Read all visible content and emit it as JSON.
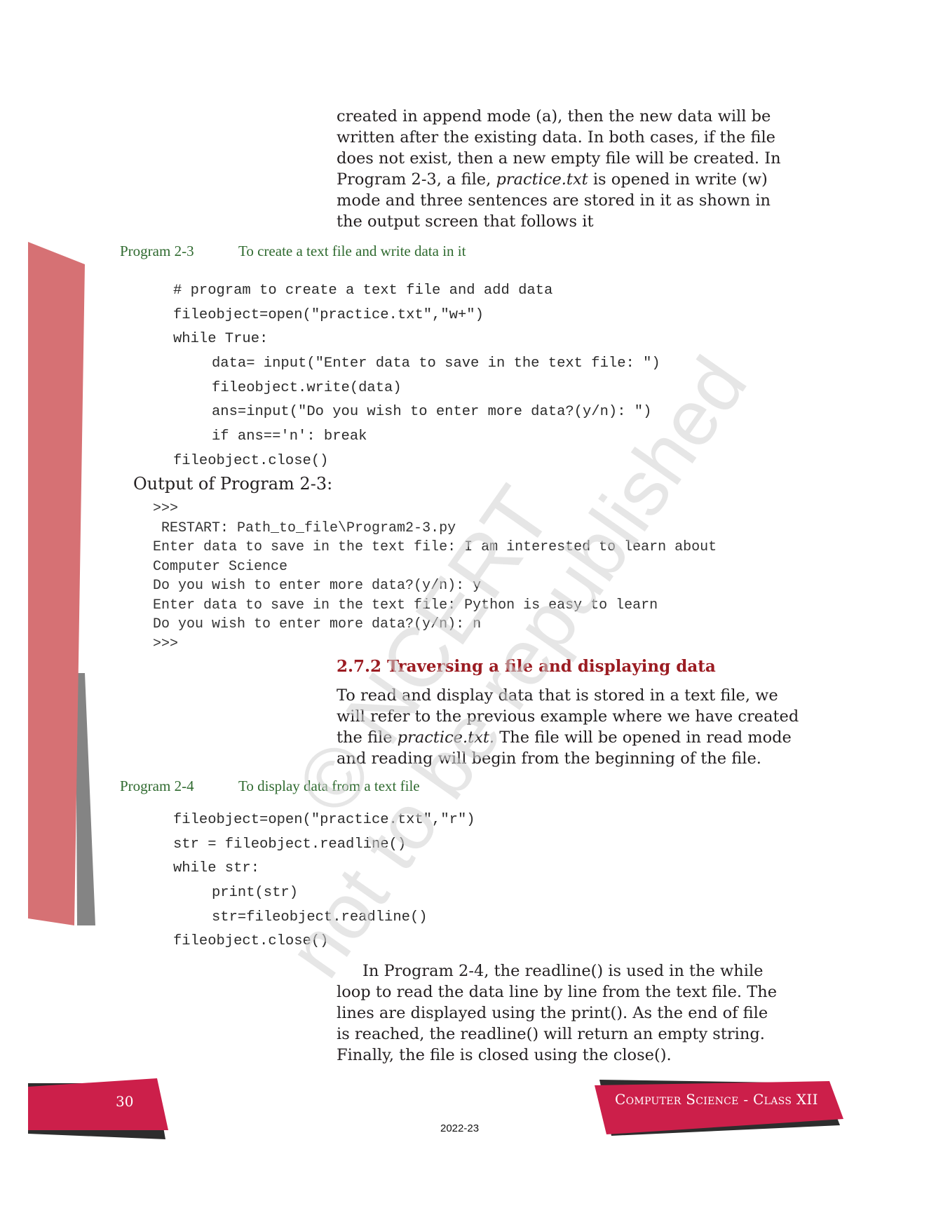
{
  "intro_paragraph": {
    "lines": [
      "created in append mode (a), then the new data will be",
      "written after the existing data. In both cases, if the file",
      "does not exist, then a new empty file will be created. In",
      "Program 2-3, a file, ",
      "mode and three sentences are stored in it as shown in",
      "the output screen that follows it"
    ],
    "line4_italic": "practice.txt",
    "line4_rest": " is opened in write (w)"
  },
  "program_2_3": {
    "number": "Program 2-3",
    "title": "To create a text file and write data in it",
    "code": [
      {
        "indent": 0,
        "text": "# program to create a text file and add data"
      },
      {
        "indent": 0,
        "text": "fileobject=open(\"practice.txt\",\"w+\")"
      },
      {
        "indent": 0,
        "text": "while True:"
      },
      {
        "indent": 1,
        "text": "data= input(\"Enter data to save in the text file: \")"
      },
      {
        "indent": 1,
        "text": "fileobject.write(data)"
      },
      {
        "indent": 1,
        "text": "ans=input(\"Do you wish to enter more data?(y/n): \")"
      },
      {
        "indent": 1,
        "text": "if ans=='n': break"
      },
      {
        "indent": 0,
        "text": "fileobject.close()"
      }
    ]
  },
  "output_2_3": {
    "title": "Output of Program 2-3:",
    "lines": [
      ">>>",
      " RESTART: Path_to_file\\Program2-3.py",
      "Enter data to save in the text file: I am interested to learn about",
      "Computer Science",
      "Do you wish to enter more data?(y/n): y",
      "Enter data to save in the text file: Python is easy to learn",
      "Do you wish to enter more data?(y/n): n",
      ">>>"
    ]
  },
  "section_2_7_2": {
    "heading": "2.7.2 Traversing a file and displaying data",
    "lines": [
      "To read and display data that is stored in a text file, we",
      "will refer to the previous example where we have created",
      "the file ",
      "and reading will begin from the beginning of the file."
    ],
    "line3_italic": "practice.txt.",
    "line3_rest": " The file will be opened in read mode"
  },
  "program_2_4": {
    "number": "Program 2-4",
    "title": "To display data from a text file",
    "code": [
      {
        "indent": 0,
        "text": "fileobject=open(\"practice.txt\",\"r\")"
      },
      {
        "indent": 0,
        "text": "str = fileobject.readline()"
      },
      {
        "indent": 0,
        "text": "while str:"
      },
      {
        "indent": 1,
        "text": "print(str)"
      },
      {
        "indent": 1,
        "text": "str=fileobject.readline()"
      },
      {
        "indent": 0,
        "text": "fileobject.close()"
      }
    ]
  },
  "explanation_paragraph": {
    "lines": [
      "In Program 2-4, the readline() is used in the while",
      "loop to read the data line by line from the text file. The",
      "lines are displayed using the print(). As the end of file",
      "is reached, the readline() will return an empty string.",
      "Finally, the file is closed using the close()."
    ]
  },
  "watermark": {
    "line1": "© NCERT",
    "line2": "not to be republished"
  },
  "footer": {
    "page_number": "30",
    "book_title": "Computer Science - Class XII",
    "year": "2022-23"
  },
  "colors": {
    "caption_green": "#2f6a2f",
    "heading_red": "#9b1c22",
    "footer_crimson": "#cc1f4a",
    "side_pink": "#d67174",
    "side_gray": "#848484",
    "footer_dark": "#2d2d2d"
  }
}
